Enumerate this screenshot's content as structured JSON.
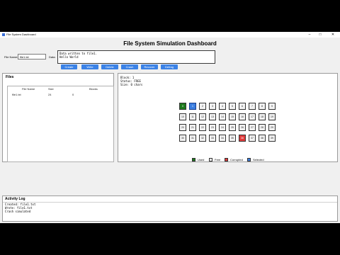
{
  "window": {
    "title": "File System Dashboard",
    "controls": {
      "minimize": "–",
      "maximize": "□",
      "close": "✕"
    }
  },
  "header": {
    "title": "File System Simulation Dashboard"
  },
  "form": {
    "filename_label": "File Name:",
    "filename_value": "file1.txt",
    "data_label": "Data:",
    "data_value": "Data written to file1.\nHello World"
  },
  "toolbar": {
    "create": "Create",
    "write": "Write",
    "delete": "Delete",
    "crash": "Crash",
    "recover": "Recover",
    "defrag": "Defrag"
  },
  "files_panel": {
    "title": "Files",
    "columns": [
      "File Name",
      "Size",
      "Blocks"
    ],
    "rows": [
      {
        "name": "file1.txt",
        "size": "24",
        "blocks": "0"
      }
    ]
  },
  "block_panel": {
    "info": "Block: 1\nStatus: FREE\nSize: 0 chars",
    "blocks": [
      {
        "label": "0",
        "state": "used"
      },
      {
        "label": "1",
        "state": "selected"
      },
      {
        "label": "2",
        "state": "free"
      },
      {
        "label": "3",
        "state": "free"
      },
      {
        "label": "4",
        "state": "free"
      },
      {
        "label": "5",
        "state": "free"
      },
      {
        "label": "6",
        "state": "free"
      },
      {
        "label": "7",
        "state": "free"
      },
      {
        "label": "8",
        "state": "free"
      },
      {
        "label": "9",
        "state": "free"
      },
      {
        "label": "10",
        "state": "free"
      },
      {
        "label": "11",
        "state": "free"
      },
      {
        "label": "12",
        "state": "free"
      },
      {
        "label": "13",
        "state": "free"
      },
      {
        "label": "14",
        "state": "free"
      },
      {
        "label": "15",
        "state": "free"
      },
      {
        "label": "16",
        "state": "free"
      },
      {
        "label": "17",
        "state": "free"
      },
      {
        "label": "18",
        "state": "free"
      },
      {
        "label": "19",
        "state": "free"
      },
      {
        "label": "20",
        "state": "free"
      },
      {
        "label": "21",
        "state": "free"
      },
      {
        "label": "22",
        "state": "free"
      },
      {
        "label": "23",
        "state": "free"
      },
      {
        "label": "24",
        "state": "free"
      },
      {
        "label": "25",
        "state": "free"
      },
      {
        "label": "26",
        "state": "free"
      },
      {
        "label": "27",
        "state": "free"
      },
      {
        "label": "28",
        "state": "free"
      },
      {
        "label": "29",
        "state": "free"
      },
      {
        "label": "30",
        "state": "free"
      },
      {
        "label": "31",
        "state": "free"
      },
      {
        "label": "32",
        "state": "free"
      },
      {
        "label": "33",
        "state": "free"
      },
      {
        "label": "34",
        "state": "free"
      },
      {
        "label": "35",
        "state": "free"
      },
      {
        "label": "36",
        "state": "corrupted"
      },
      {
        "label": "37",
        "state": "free"
      },
      {
        "label": "38",
        "state": "free"
      },
      {
        "label": "39",
        "state": "free"
      }
    ],
    "legend": [
      {
        "label": "Used",
        "color": "#1e7a1e"
      },
      {
        "label": "Free",
        "color": "#f2f2f2"
      },
      {
        "label": "Corrupted",
        "color": "#e03a3a"
      },
      {
        "label": "Selected",
        "color": "#3d7fe0"
      }
    ]
  },
  "activity_log": {
    "title": "Activity Log",
    "lines": "Created: file1.txt\nWrote: file1.txt\nCrash simulated"
  }
}
